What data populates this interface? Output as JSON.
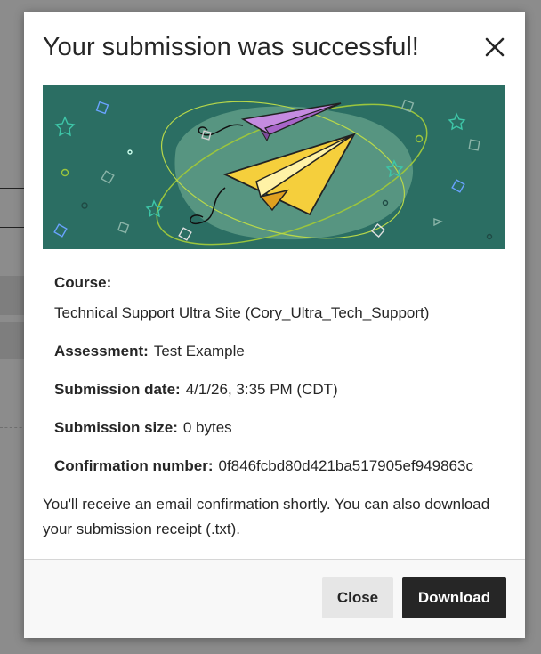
{
  "dialog": {
    "title": "Your submission was successful!",
    "close_icon": "close-icon"
  },
  "details": {
    "course_label": "Course:",
    "course_value": "Technical Support Ultra Site (Cory_Ultra_Tech_Support)",
    "assessment_label": "Assessment:",
    "assessment_value": "Test Example",
    "date_label": "Submission date:",
    "date_value": "4/1/26, 3:35 PM (CDT)",
    "size_label": "Submission size:",
    "size_value": "0 bytes",
    "confirmation_label": "Confirmation number:",
    "confirmation_value": "0f846fcbd80d421ba517905ef949863c"
  },
  "note": "You'll receive an email confirmation shortly. You can also download your submission receipt (.txt).",
  "footer": {
    "close_label": "Close",
    "download_label": "Download"
  },
  "colors": {
    "banner_bg": "#2b6e63",
    "primary_button": "#262626",
    "secondary_button": "#e6e6e6"
  }
}
